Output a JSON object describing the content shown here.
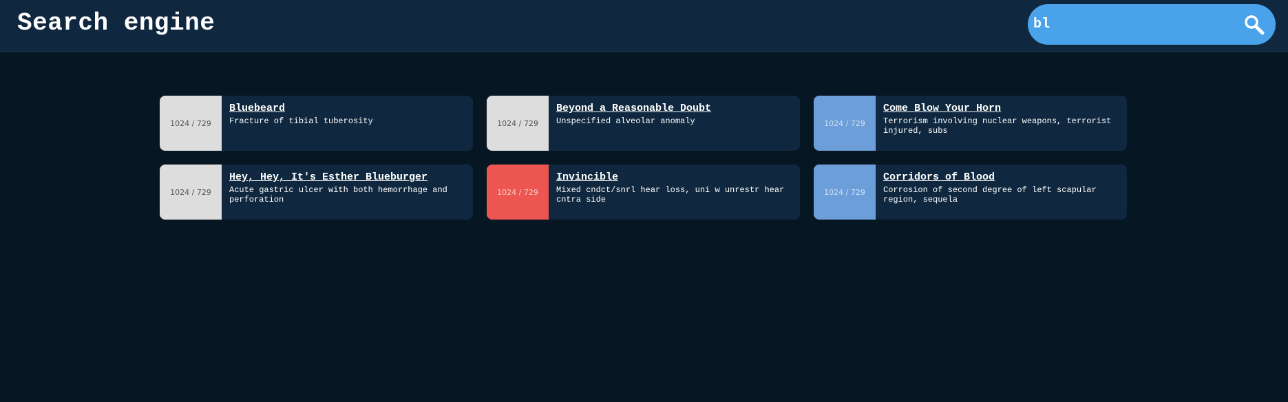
{
  "header": {
    "title": "Search engine"
  },
  "search": {
    "value": "bl",
    "placeholder": "",
    "icon": "search-icon"
  },
  "colors": {
    "header_bg": "#10283f",
    "page_bg": "#061723",
    "search_bg": "#4aa3ea",
    "card_bg": "#10283f"
  },
  "results": [
    {
      "title": "Bluebeard",
      "description": "Fracture of tibial tuberosity",
      "thumb_label": "1024 / 729",
      "thumb_color": "#dddddd"
    },
    {
      "title": "Beyond a Reasonable Doubt",
      "description": "Unspecified alveolar anomaly",
      "thumb_label": "1024 / 729",
      "thumb_color": "#dddddd"
    },
    {
      "title": "Come Blow Your Horn",
      "description": "Terrorism involving nuclear weapons, terrorist injured, subs",
      "thumb_label": "1024 / 729",
      "thumb_color": "#6c9fd9"
    },
    {
      "title": "Hey, Hey, It's Esther Blueburger",
      "description": "Acute gastric ulcer with both hemorrhage and perforation",
      "thumb_label": "1024 / 729",
      "thumb_color": "#dddddd"
    },
    {
      "title": "Invincible",
      "description": "Mixed cndct/snrl hear loss, uni w unrestr hear cntra side",
      "thumb_label": "1024 / 729",
      "thumb_color": "#ed5650"
    },
    {
      "title": "Corridors of Blood",
      "description": "Corrosion of second degree of left scapular region, sequela",
      "thumb_label": "1024 / 729",
      "thumb_color": "#6c9fd9"
    }
  ]
}
